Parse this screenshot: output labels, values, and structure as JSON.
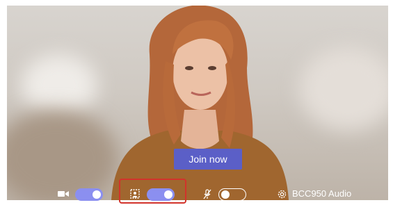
{
  "main": {
    "join_label": "Join now"
  },
  "controls": {
    "camera": {
      "icon": "video-camera-icon",
      "state": "on"
    },
    "background_effects": {
      "icon": "background-effects-icon",
      "state": "on"
    },
    "microphone": {
      "icon": "microphone-muted-icon",
      "state": "off"
    },
    "audio_device": {
      "icon": "gear-icon",
      "label": "BCC950 Audio"
    }
  },
  "colors": {
    "join_button": "#5b5fc7",
    "toggle_on": "#8b8ff0",
    "highlight": "#d2332b"
  }
}
